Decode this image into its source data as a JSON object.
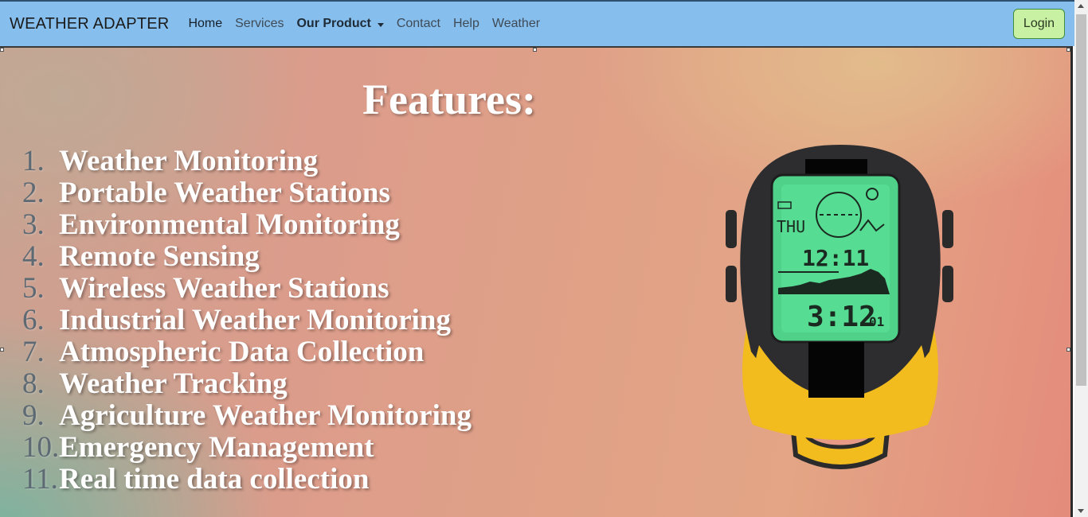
{
  "navbar": {
    "brand": "WEATHER ADAPTER",
    "links": [
      "Home",
      "Services",
      "Our Product",
      "Contact",
      "Help",
      "Weather"
    ],
    "login_label": "Login",
    "background_color": "#86bfee",
    "login_color": "#c9f1a3"
  },
  "hero": {
    "title": "Features:",
    "features": [
      {
        "num": "1.",
        "text": "Weather Monitoring"
      },
      {
        "num": "2.",
        "text": "Portable Weather Stations"
      },
      {
        "num": "3.",
        "text": "Environmental Monitoring"
      },
      {
        "num": "4.",
        "text": "Remote Sensing"
      },
      {
        "num": "5.",
        "text": "Wireless Weather Stations"
      },
      {
        "num": "6.",
        "text": "Industrial Weather Monitoring"
      },
      {
        "num": "7.",
        "text": "Atmospheric Data Collection"
      },
      {
        "num": "8.",
        "text": "Weather Tracking"
      },
      {
        "num": "9.",
        "text": "Agriculture Weather Monitoring"
      },
      {
        "num": "10.",
        "text": "Emergency Management"
      },
      {
        "num": "11.",
        "text": "Real time data collection"
      }
    ]
  },
  "device": {
    "day": "THU",
    "time_upper": "12:11",
    "time_lower": "3:12",
    "seconds": "01",
    "body_color": "#f2bb1e",
    "screen_color": "#4fd18a"
  }
}
